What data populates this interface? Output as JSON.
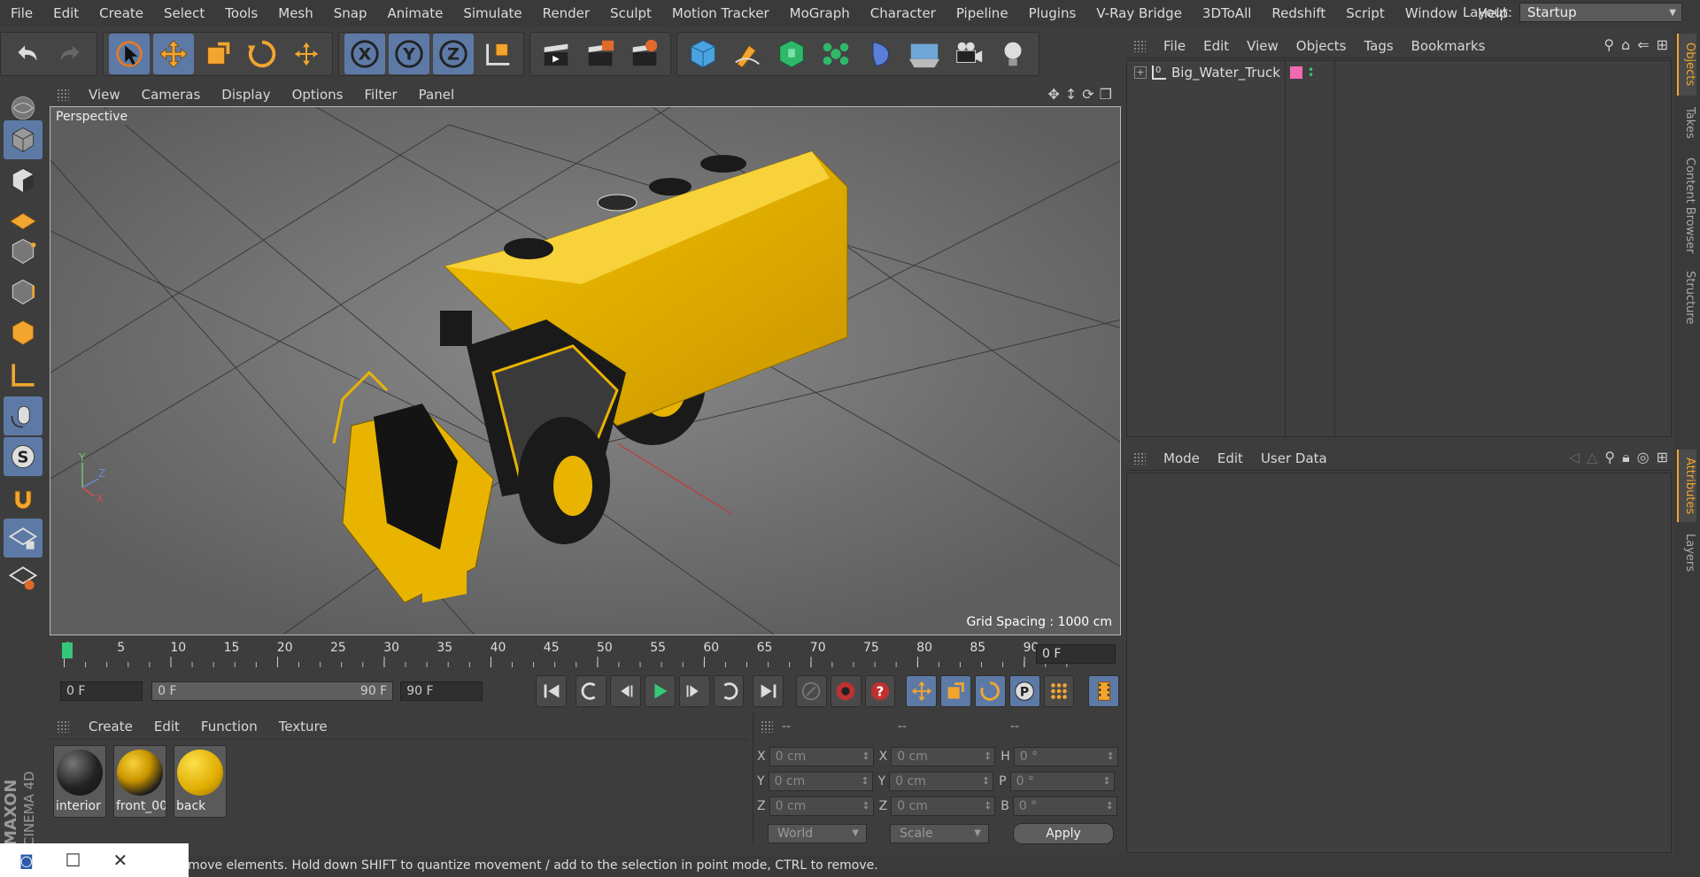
{
  "menubar": {
    "items": [
      "File",
      "Edit",
      "Create",
      "Select",
      "Tools",
      "Mesh",
      "Snap",
      "Animate",
      "Simulate",
      "Render",
      "Sculpt",
      "Motion Tracker",
      "MoGraph",
      "Character",
      "Pipeline",
      "Plugins",
      "V-Ray Bridge",
      "3DToAll",
      "Redshift",
      "Script",
      "Window",
      "Help"
    ],
    "layout_label": "Layout:",
    "layout_value": "Startup"
  },
  "toolbar": {
    "icons": [
      "undo-icon",
      "redo-icon",
      "live-selection-icon",
      "move-icon",
      "scale-icon",
      "rotate-icon",
      "last-tool-icon",
      "x-axis-icon",
      "y-axis-icon",
      "z-axis-icon",
      "coordinate-system-icon",
      "render-view-icon",
      "render-picture-viewer-icon",
      "edit-render-settings-icon",
      "cube-icon",
      "pen-icon",
      "subdivision-icon",
      "cloner-icon",
      "deformer-icon",
      "floor-icon",
      "camera-icon",
      "light-icon"
    ],
    "axis_x": "X",
    "axis_y": "Y",
    "axis_z": "Z"
  },
  "left_tools": {
    "icons": [
      "make-editable-icon",
      "model-mode-icon",
      "texture-mode-icon",
      "workplane-icon",
      "points-mode-icon",
      "edges-mode-icon",
      "polygons-mode-icon",
      "axis-mode-icon",
      "tweak-mode-icon",
      "solo-icon",
      "snap-icon",
      "workplane-lock-icon",
      "locked-workplane-icon"
    ]
  },
  "viewport": {
    "menu": [
      "View",
      "Cameras",
      "Display",
      "Options",
      "Filter",
      "Panel"
    ],
    "label": "Perspective",
    "grid_spacing": "Grid Spacing : 1000 cm",
    "axis_labels": {
      "x": "X",
      "y": "Y",
      "z": "Z"
    }
  },
  "timeline": {
    "ticks": [
      "0",
      "5",
      "10",
      "15",
      "20",
      "25",
      "30",
      "35",
      "40",
      "45",
      "50",
      "55",
      "60",
      "65",
      "70",
      "75",
      "80",
      "85",
      "90"
    ],
    "current_frame": "0 F"
  },
  "transport": {
    "start_field": "0 F",
    "range_start": "0 F",
    "range_end": "90 F",
    "end_field": "90 F"
  },
  "materials": {
    "menu": [
      "Create",
      "Edit",
      "Function",
      "Texture"
    ],
    "items": [
      {
        "name": "interior"
      },
      {
        "name": "front_00"
      },
      {
        "name": "back"
      }
    ]
  },
  "coordinates": {
    "headers": [
      "--",
      "--",
      "--"
    ],
    "rows": [
      {
        "a": "X",
        "av": "0 cm",
        "b": "X",
        "bv": "0 cm",
        "c": "H",
        "cv": "0 °"
      },
      {
        "a": "Y",
        "av": "0 cm",
        "b": "Y",
        "bv": "0 cm",
        "c": "P",
        "cv": "0 °"
      },
      {
        "a": "Z",
        "av": "0 cm",
        "b": "Z",
        "bv": "0 cm",
        "c": "B",
        "cv": "0 °"
      }
    ],
    "mode": "World",
    "type": "Scale",
    "apply": "Apply"
  },
  "objects": {
    "menu": [
      "File",
      "Edit",
      "View",
      "Objects",
      "Tags",
      "Bookmarks"
    ],
    "items": [
      {
        "name": "Big_Water_Truck",
        "layer": "0"
      }
    ]
  },
  "attributes": {
    "menu": [
      "Mode",
      "Edit",
      "User Data"
    ]
  },
  "right_tabs": [
    "Objects",
    "Takes",
    "Content Browser",
    "Structure",
    "Attributes",
    "Layers"
  ],
  "status": {
    "text": "move elements. Hold down SHIFT to quantize movement / add to the selection in point mode, CTRL to remove."
  },
  "logo": {
    "line1": "MAXON",
    "line2": "CINEMA 4D"
  },
  "colors": {
    "accent": "#5d7aa6",
    "orange": "#f2a62f",
    "truck": "#e8b400",
    "playhead": "#35c879"
  }
}
